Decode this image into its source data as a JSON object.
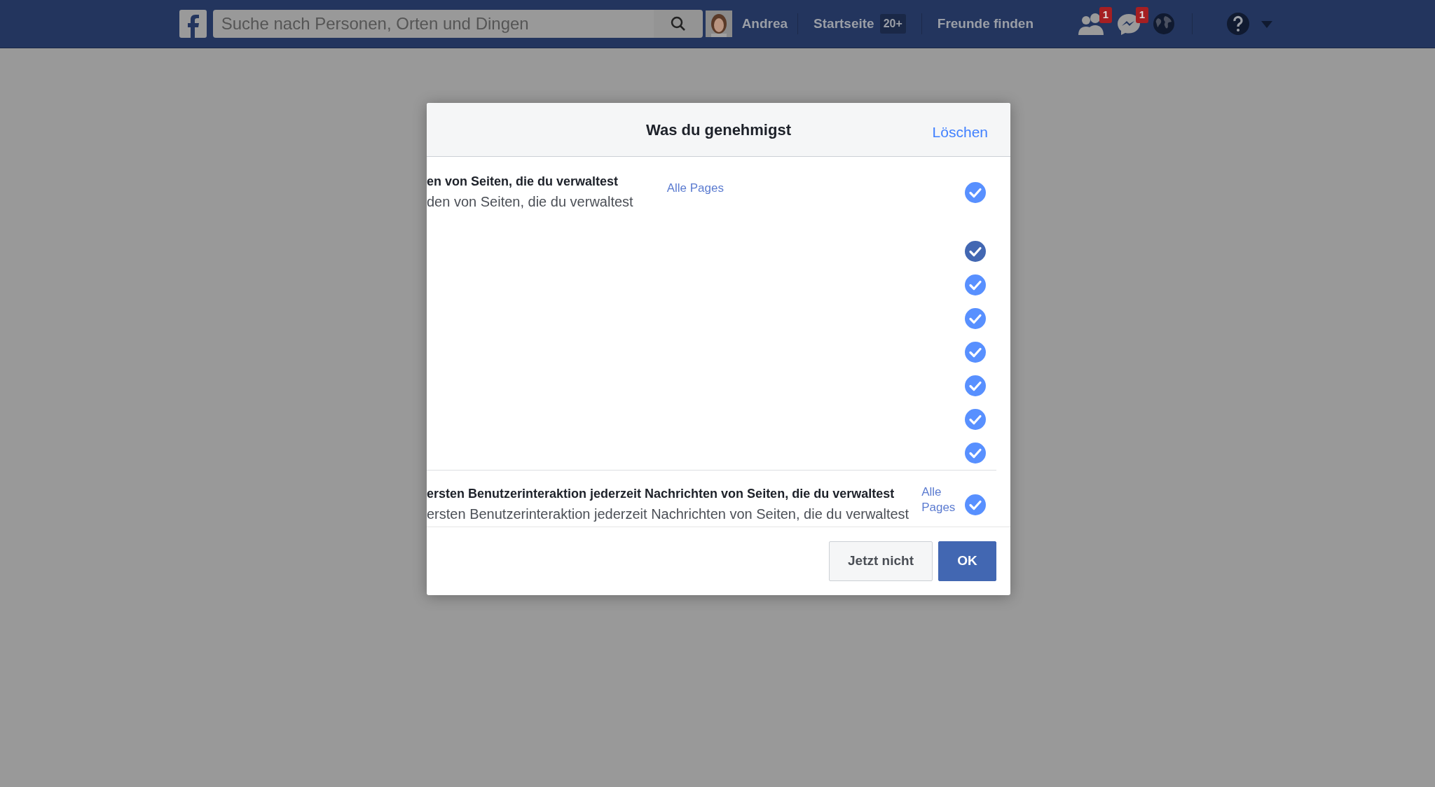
{
  "topbar": {
    "search": {
      "placeholder": "Suche nach Personen, Orten und Dingen"
    },
    "user": "Andrea",
    "nav": [
      {
        "label": "Startseite",
        "badge": "20+"
      },
      {
        "label": "Freunde finden"
      }
    ],
    "icons": [
      {
        "kind": "friends",
        "badge": "1"
      },
      {
        "kind": "messages",
        "badge": "1"
      },
      {
        "kind": "globe"
      },
      {
        "kind": "help"
      },
      {
        "kind": "caret"
      }
    ]
  },
  "dialog": {
    "title": "Was du genehmigst",
    "clear_link": "Löschen",
    "groups": [
      {
        "rows": [
          {
            "kind": "text",
            "title": "en von Seiten, die du verwaltest",
            "subtitle": "den von Seiten, die du verwaltest",
            "link": "Alle Pages",
            "checked": true,
            "hovered": false
          },
          {
            "kind": "blank",
            "checked": true,
            "hovered": true
          },
          {
            "kind": "blank",
            "checked": true,
            "hovered": false
          },
          {
            "kind": "blank",
            "checked": true,
            "hovered": false
          },
          {
            "kind": "blank",
            "checked": true,
            "hovered": false
          },
          {
            "kind": "blank",
            "checked": true,
            "hovered": false
          },
          {
            "kind": "blank",
            "checked": true,
            "hovered": false
          },
          {
            "kind": "blank",
            "checked": true,
            "hovered": false
          }
        ]
      },
      {
        "rows": [
          {
            "kind": "text",
            "title": "ersten Benutzerinteraktion jederzeit Nachrichten von Seiten, die du verwaltest",
            "subtitle": "ersten Benutzerinteraktion jederzeit Nachrichten von Seiten, die du verwaltest",
            "link": "Alle Pages",
            "checked": true,
            "hovered": false
          }
        ]
      }
    ],
    "buttons": [
      {
        "label": "Jetzt nicht",
        "kind": "secondary"
      },
      {
        "label": "OK",
        "kind": "primary"
      }
    ]
  }
}
